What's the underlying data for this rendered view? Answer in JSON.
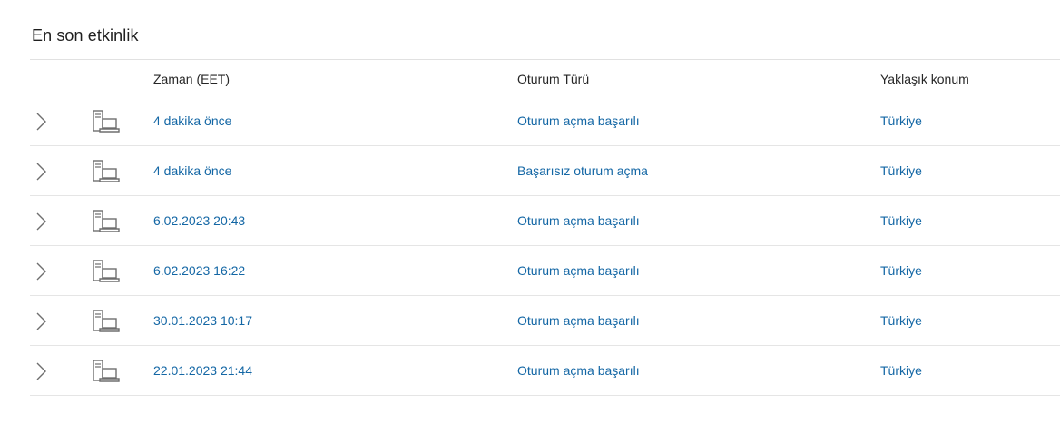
{
  "section": {
    "title": "En son etkinlik"
  },
  "table": {
    "headers": {
      "time": "Zaman (EET)",
      "type": "Oturum Türü",
      "location": "Yaklaşık konum"
    },
    "rows": [
      {
        "time": "4 dakika önce",
        "type": "Oturum açma başarılı",
        "location": "Türkiye",
        "icon": "computer-icon"
      },
      {
        "time": "4 dakika önce",
        "type": "Başarısız oturum açma",
        "location": "Türkiye",
        "icon": "computer-icon"
      },
      {
        "time": "6.02.2023 20:43",
        "type": "Oturum açma başarılı",
        "location": "Türkiye",
        "icon": "computer-icon"
      },
      {
        "time": "6.02.2023 16:22",
        "type": "Oturum açma başarılı",
        "location": "Türkiye",
        "icon": "computer-icon"
      },
      {
        "time": "30.01.2023 10:17",
        "type": "Oturum açma başarılı",
        "location": "Türkiye",
        "icon": "computer-icon"
      },
      {
        "time": "22.01.2023 21:44",
        "type": "Oturum açma başarılı",
        "location": "Türkiye",
        "icon": "computer-icon"
      }
    ]
  },
  "colors": {
    "link": "#1467a5",
    "text": "#262626",
    "divider": "#e5e5e5",
    "icon": "#6e6e6e"
  }
}
